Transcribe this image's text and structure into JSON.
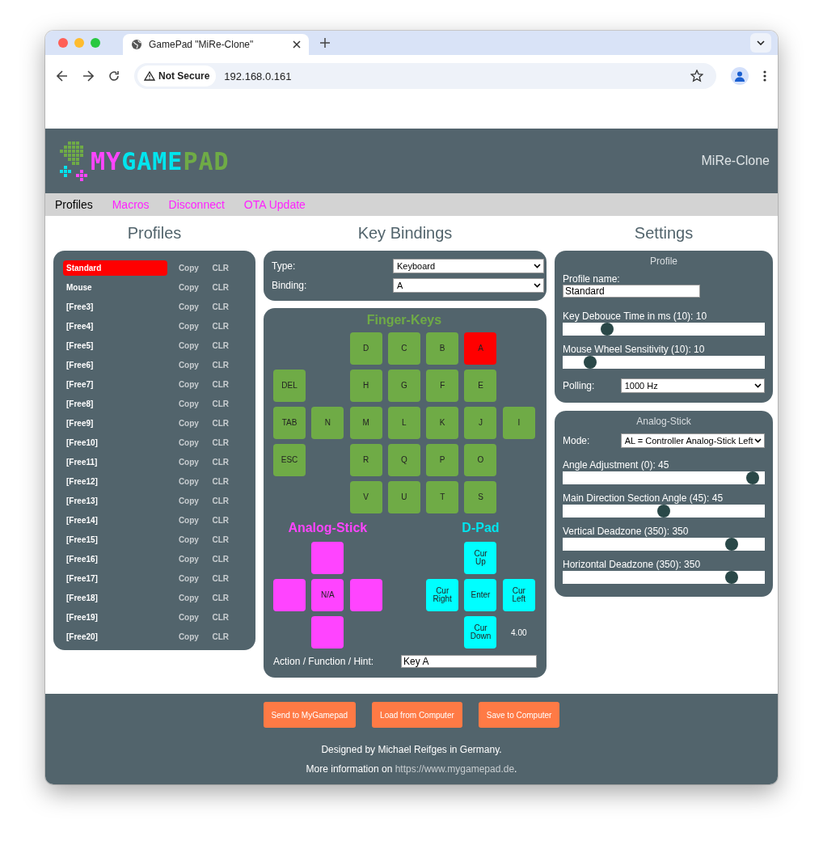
{
  "browser": {
    "tab_title": "GamePad \"MiRe-Clone\"",
    "security_label": "Not Secure",
    "url": "192.168.0.161"
  },
  "header": {
    "logo": [
      {
        "text": "MY",
        "color": "#ff44ff"
      },
      {
        "text": "GAME",
        "color": "#00e5ee"
      },
      {
        "text": "PAD",
        "color": "#6fab46"
      }
    ],
    "device_name": "MiRe-Clone"
  },
  "nav": [
    {
      "label": "Profiles",
      "selected": true
    },
    {
      "label": "Macros",
      "selected": false
    },
    {
      "label": "Disconnect",
      "selected": false
    },
    {
      "label": "OTA Update",
      "selected": false
    }
  ],
  "profiles": {
    "title": "Profiles",
    "items": [
      {
        "name": "Standard",
        "selected": true,
        "copy": "Copy",
        "clear": "CLR"
      },
      {
        "name": "Mouse",
        "selected": false,
        "copy": "Copy",
        "clear": "CLR"
      },
      {
        "name": "[Free3]",
        "selected": false,
        "copy": "Copy",
        "clear": "CLR"
      },
      {
        "name": "[Free4]",
        "selected": false,
        "copy": "Copy",
        "clear": "CLR"
      },
      {
        "name": "[Free5]",
        "selected": false,
        "copy": "Copy",
        "clear": "CLR"
      },
      {
        "name": "[Free6]",
        "selected": false,
        "copy": "Copy",
        "clear": "CLR"
      },
      {
        "name": "[Free7]",
        "selected": false,
        "copy": "Copy",
        "clear": "CLR"
      },
      {
        "name": "[Free8]",
        "selected": false,
        "copy": "Copy",
        "clear": "CLR"
      },
      {
        "name": "[Free9]",
        "selected": false,
        "copy": "Copy",
        "clear": "CLR"
      },
      {
        "name": "[Free10]",
        "selected": false,
        "copy": "Copy",
        "clear": "CLR"
      },
      {
        "name": "[Free11]",
        "selected": false,
        "copy": "Copy",
        "clear": "CLR"
      },
      {
        "name": "[Free12]",
        "selected": false,
        "copy": "Copy",
        "clear": "CLR"
      },
      {
        "name": "[Free13]",
        "selected": false,
        "copy": "Copy",
        "clear": "CLR"
      },
      {
        "name": "[Free14]",
        "selected": false,
        "copy": "Copy",
        "clear": "CLR"
      },
      {
        "name": "[Free15]",
        "selected": false,
        "copy": "Copy",
        "clear": "CLR"
      },
      {
        "name": "[Free16]",
        "selected": false,
        "copy": "Copy",
        "clear": "CLR"
      },
      {
        "name": "[Free17]",
        "selected": false,
        "copy": "Copy",
        "clear": "CLR"
      },
      {
        "name": "[Free18]",
        "selected": false,
        "copy": "Copy",
        "clear": "CLR"
      },
      {
        "name": "[Free19]",
        "selected": false,
        "copy": "Copy",
        "clear": "CLR"
      },
      {
        "name": "[Free20]",
        "selected": false,
        "copy": "Copy",
        "clear": "CLR"
      }
    ]
  },
  "key_bindings": {
    "title": "Key Bindings",
    "type_label": "Type:",
    "type_value": "Keyboard",
    "binding_label": "Binding:",
    "binding_value": "A",
    "finger_keys": {
      "title": "Finger-Keys",
      "keys": [
        {
          "label": "D",
          "selected": false
        },
        {
          "label": "C",
          "selected": false
        },
        {
          "label": "B",
          "selected": false
        },
        {
          "label": "A",
          "selected": true
        },
        {
          "label": "DEL",
          "selected": false
        },
        {
          "label": "H",
          "selected": false
        },
        {
          "label": "G",
          "selected": false
        },
        {
          "label": "F",
          "selected": false
        },
        {
          "label": "E",
          "selected": false
        },
        {
          "label": "TAB",
          "selected": false
        },
        {
          "label": "N",
          "selected": false
        },
        {
          "label": "M",
          "selected": false
        },
        {
          "label": "L",
          "selected": false
        },
        {
          "label": "K",
          "selected": false
        },
        {
          "label": "J",
          "selected": false
        },
        {
          "label": "I",
          "selected": false
        },
        {
          "label": "ESC",
          "selected": false
        },
        {
          "label": "R",
          "selected": false
        },
        {
          "label": "Q",
          "selected": false
        },
        {
          "label": "P",
          "selected": false
        },
        {
          "label": "O",
          "selected": false
        },
        {
          "label": "V",
          "selected": false
        },
        {
          "label": "U",
          "selected": false
        },
        {
          "label": "T",
          "selected": false
        },
        {
          "label": "S",
          "selected": false
        }
      ]
    },
    "analog_stick": {
      "title": "Analog-Stick",
      "keys": [
        {
          "selected": false
        },
        {
          "selected": false
        },
        {
          "label": "N/A",
          "selected": false
        },
        {
          "selected": false
        },
        {
          "selected": false
        }
      ]
    },
    "d_pad": {
      "title": "D-Pad",
      "keys": [
        {
          "label": "Cur Up",
          "selected": false
        },
        {
          "label": "Cur Right",
          "selected": false
        },
        {
          "label": "Enter",
          "selected": false
        },
        {
          "label": "Cur Left",
          "selected": false
        },
        {
          "label": "Cur Down",
          "selected": false
        }
      ],
      "reading": "4.00"
    },
    "hint_label": "Action / Function / Hint:",
    "hint_value": "Key A"
  },
  "settings": {
    "title": "Settings",
    "profile": {
      "title": "Profile",
      "name_label": "Profile name:",
      "name_value": "Standard",
      "sliders": [
        {
          "label": "Key Debouce Time in ms (10): 10",
          "level": 0.2
        },
        {
          "label": "Mouse Wheel Sensitivity (10): 10",
          "level": 0.11
        }
      ],
      "polling_label": "Polling:",
      "polling_value": "1000 Hz"
    },
    "analog_stick": {
      "title": "Analog-Stick",
      "mode_label": "Mode:",
      "mode_value": "AL = Controller Analog-Stick Left",
      "sliders": [
        {
          "label": "Angle Adjustment (0): 45",
          "level": 0.97
        },
        {
          "label": "Main Direction Section Angle (45): 45",
          "level": 0.5
        },
        {
          "label": "Vertical Deadzone (350): 350",
          "level": 0.86
        },
        {
          "label": "Horizontal Deadzone (350): 350",
          "level": 0.86
        }
      ]
    }
  },
  "footer": {
    "buttons": [
      "Send to MyGamepad",
      "Load from Computer",
      "Save to Computer"
    ],
    "credit": "Designed by Michael Reifges in Germany.",
    "more_info": {
      "text": "More information on",
      "link": "https://www.mygamepad.de",
      "end": "."
    }
  }
}
